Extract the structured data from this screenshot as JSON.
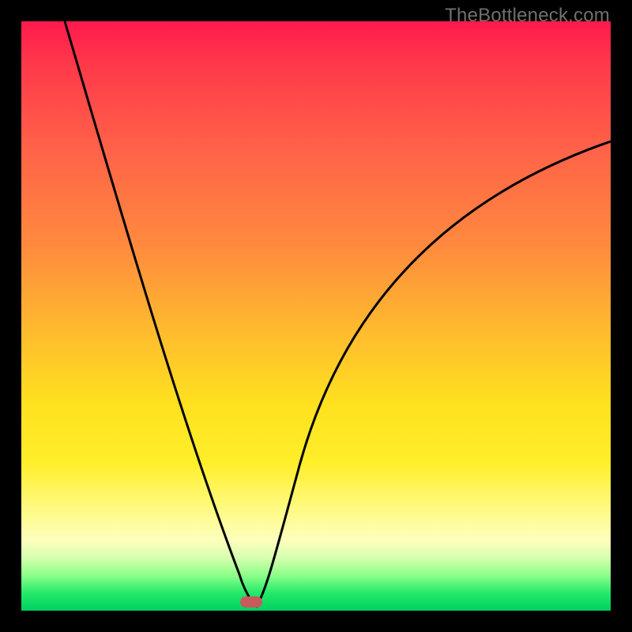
{
  "watermark": "TheBottleneck.com",
  "chart_data": {
    "type": "line",
    "title": "",
    "xlabel": "",
    "ylabel": "",
    "xlim": [
      0,
      1
    ],
    "ylim": [
      0,
      1
    ],
    "series": [
      {
        "name": "curve",
        "x": [
          0.0,
          0.05,
          0.1,
          0.15,
          0.2,
          0.25,
          0.3,
          0.34,
          0.37,
          0.39,
          0.4,
          0.41,
          0.43,
          0.46,
          0.5,
          0.55,
          0.6,
          0.65,
          0.7,
          0.75,
          0.8,
          0.85,
          0.9,
          0.95,
          1.0
        ],
        "values": [
          1.0,
          0.85,
          0.71,
          0.58,
          0.46,
          0.35,
          0.24,
          0.13,
          0.06,
          0.02,
          0.01,
          0.02,
          0.06,
          0.14,
          0.25,
          0.37,
          0.46,
          0.53,
          0.59,
          0.64,
          0.68,
          0.72,
          0.75,
          0.78,
          0.8
        ]
      }
    ],
    "marker": {
      "x": 0.39,
      "y": 0.01,
      "color": "#c85a5c"
    },
    "background_gradient": {
      "stops": [
        {
          "pos": 0.0,
          "color": "#ff1a4d"
        },
        {
          "pos": 0.5,
          "color": "#ffd22a"
        },
        {
          "pos": 0.88,
          "color": "#fdffbd"
        },
        {
          "pos": 1.0,
          "color": "#00d060"
        }
      ]
    }
  }
}
